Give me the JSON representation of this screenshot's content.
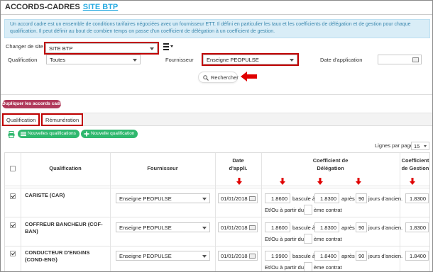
{
  "header": {
    "title": "ACCORDS-CADRES",
    "site_link": "SITE BTP"
  },
  "info_text": "Un accord cadre est un ensemble de conditions tarifaires négociées avec un fournisseur ETT. Il défini en particulier les taux et les coefficients de délégation et de gestion pour chaque qualification. Il peut définir au bout de combien temps on passe d'un coefficient de délégation à un coefficient de gestion.",
  "filters": {
    "site_label": "Changer de site",
    "site_value": "SITE BTP",
    "qualification_label": "Qualification",
    "qualification_value": "Toutes",
    "fournisseur_label": "Fournisseur",
    "fournisseur_value": "Enseigne PEOPULSE",
    "date_label": "Date d'application",
    "search_label": "Rechercher"
  },
  "actions": {
    "duplicate_label": "Dupliquer les accords cadres"
  },
  "tabs": [
    {
      "label": "Qualification"
    },
    {
      "label": "Rémunération"
    }
  ],
  "toolbar": {
    "nouvelles_label": "Nouvelles qualifications",
    "nouvelle_label": "Nouvelle qualification"
  },
  "paging": {
    "label": "Lignes par page:",
    "value": "15"
  },
  "columns": {
    "qualification": "Qualification",
    "fournisseur": "Fournisseur",
    "date_line1": "Date",
    "date_line2": "d'appli.",
    "delegation_line1": "Coefficient de",
    "delegation_line2": "Délégation",
    "gestion_line1": "Coefficient",
    "gestion_line2": "de Gestion"
  },
  "row_text": {
    "bascule": "bascule à",
    "apres": "après",
    "jours": "jours d'ancien.",
    "etou": "Et/Ou à partir du",
    "eme": "ème contrat"
  },
  "rows": [
    {
      "qualification": "CARISTE (CAR)",
      "fournisseur": "Enseigne PEOPULSE",
      "date": "01/01/2018",
      "coef_delegation": "1.8600",
      "bascule": "1.8300",
      "jours": "90",
      "coef_gestion": "1.8300",
      "checked": true
    },
    {
      "qualification": "COFFREUR BANCHEUR (COF-BAN)",
      "fournisseur": "Enseigne PEOPULSE",
      "date": "01/01/2018",
      "coef_delegation": "1.8600",
      "bascule": "1.8300",
      "jours": "90",
      "coef_gestion": "1.8300",
      "checked": true
    },
    {
      "qualification": "CONDUCTEUR D'ENGINS (COND-ENG)",
      "fournisseur": "Enseigne PEOPULSE",
      "date": "01/01/2018",
      "coef_delegation": "1.9900",
      "bascule": "1.8400",
      "jours": "90",
      "coef_gestion": "1.8400",
      "checked": true
    }
  ]
}
